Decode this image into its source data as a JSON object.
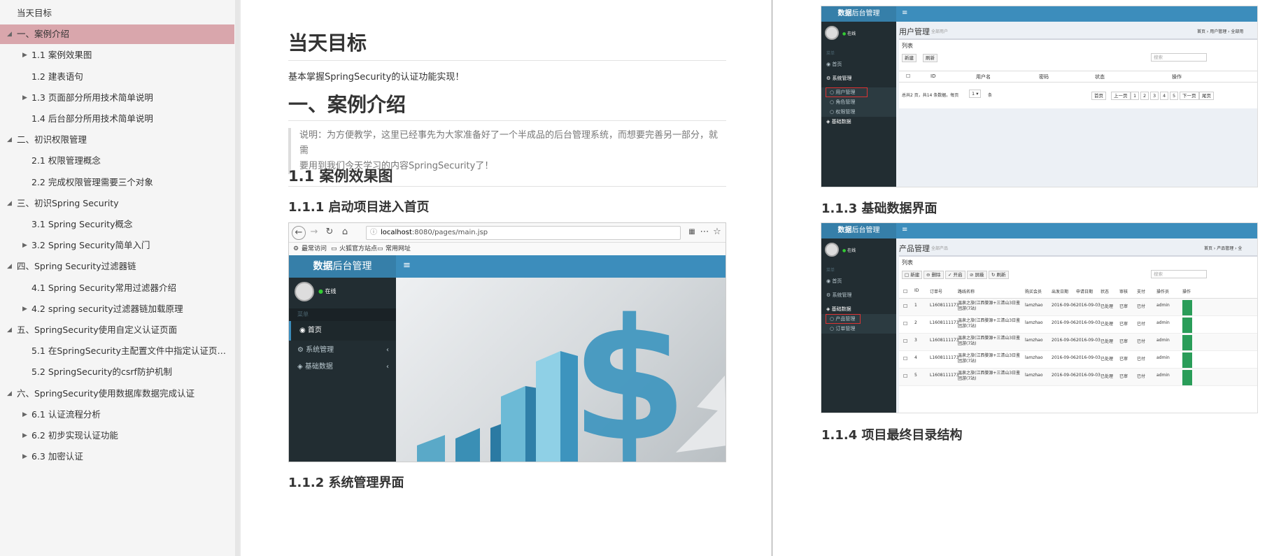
{
  "outline": {
    "items": [
      {
        "label": "当天目标",
        "level": 0,
        "arrow": ""
      },
      {
        "label": "一、案例介绍",
        "level": 0,
        "arrow": "◢",
        "selected": true
      },
      {
        "label": "1.1 案例效果图",
        "level": 1,
        "arrow": "▶"
      },
      {
        "label": "1.2 建表语句",
        "level": 1,
        "arrow": ""
      },
      {
        "label": "1.3 页面部分所用技术简单说明",
        "level": 1,
        "arrow": "▶"
      },
      {
        "label": "1.4 后台部分所用技术简单说明",
        "level": 1,
        "arrow": ""
      },
      {
        "label": "二、初识权限管理",
        "level": 0,
        "arrow": "◢"
      },
      {
        "label": "2.1 权限管理概念",
        "level": 1,
        "arrow": ""
      },
      {
        "label": "2.2 完成权限管理需要三个对象",
        "level": 1,
        "arrow": ""
      },
      {
        "label": "三、初识Spring Security",
        "level": 0,
        "arrow": "◢"
      },
      {
        "label": "3.1 Spring Security概念",
        "level": 1,
        "arrow": ""
      },
      {
        "label": "3.2 Spring Security简单入门",
        "level": 1,
        "arrow": "▶"
      },
      {
        "label": "四、Spring Security过滤器链",
        "level": 0,
        "arrow": "◢"
      },
      {
        "label": "4.1 Spring Security常用过滤器介绍",
        "level": 1,
        "arrow": ""
      },
      {
        "label": "4.2 spring security过滤器链加载原理",
        "level": 1,
        "arrow": "▶"
      },
      {
        "label": "五、SpringSecurity使用自定义认证页面",
        "level": 0,
        "arrow": "◢"
      },
      {
        "label": "5.1 在SpringSecurity主配置文件中指定认证页面配...",
        "level": 1,
        "arrow": ""
      },
      {
        "label": "5.2 SpringSecurity的csrf防护机制",
        "level": 1,
        "arrow": ""
      },
      {
        "label": "六、SpringSecurity使用数据库数据完成认证",
        "level": 0,
        "arrow": "◢"
      },
      {
        "label": "6.1 认证流程分析",
        "level": 1,
        "arrow": "▶"
      },
      {
        "label": "6.2 初步实现认证功能",
        "level": 1,
        "arrow": "▶"
      },
      {
        "label": "6.3 加密认证",
        "level": 1,
        "arrow": "▶"
      }
    ]
  },
  "page1": {
    "h_goal": "当天目标",
    "goal_text": "基本掌握SpringSecurity的认证功能实现！",
    "h_case": "一、案例介绍",
    "quote_line1": "说明：为方便教学，这里已经事先为大家准备好了一个半成品的后台管理系统，而想要完善另一部分，就需",
    "quote_line2": "要用到我们今天学习的内容SpringSecurity了！",
    "h_11": "1.1 案例效果图",
    "h_111": "1.1.1 启动项目进入首页",
    "h_112": "1.1.2 系统管理界面"
  },
  "browser": {
    "url_host": "localhost",
    "url_rest": ":8080/pages/main.jsp",
    "bookmarks": [
      "最常访问",
      "火狐官方站点",
      "常用网址"
    ],
    "logo_bold": "数据",
    "logo_rest": "后台管理",
    "online": "在线",
    "menu_header": "菜单",
    "menu": [
      "首页",
      "系统管理",
      "基础数据"
    ]
  },
  "page2": {
    "h_113": "1.1.3 基础数据界面",
    "h_114": "1.1.4 项目最终目录结构"
  },
  "thumb1": {
    "logo_bold": "数据",
    "logo_rest": "后台管理",
    "online": "在线",
    "menu_header": "菜单",
    "title": "用户管理",
    "subtitle": "全部用户",
    "crumb": "首页 › 用户管理 › 全部用",
    "box_title": "列表",
    "btn_new": "新建",
    "btn_refresh": "刷新",
    "search": "搜索",
    "cols": [
      "ID",
      "用户名",
      "密码",
      "状态",
      "操作"
    ],
    "page_info": "总共2 页，共14 条数据。每页",
    "page_size": "1",
    "page_unit": "条",
    "pager": [
      "首页",
      "上一页",
      "1",
      "2",
      "3",
      "4",
      "5",
      "下一页",
      "尾页"
    ],
    "side": [
      "首页",
      "系统管理",
      "用户管理",
      "角色管理",
      "权限管理",
      "基础数据"
    ]
  },
  "thumb2": {
    "logo_bold": "数据",
    "logo_rest": "后台管理",
    "online": "在线",
    "menu_header": "菜单",
    "title": "产品管理",
    "subtitle": "全部产品",
    "crumb": "首页 › 产品管理 › 全",
    "box_title": "列表",
    "btns": [
      "新建",
      "删除",
      "开启",
      "屏蔽",
      "刷新"
    ],
    "cols": [
      "ID",
      "订单号",
      "路线名称",
      "购买会员",
      "出发日期",
      "申请日期",
      "状态",
      "审核",
      "支付",
      "操作员",
      "操作"
    ],
    "side": [
      "首页",
      "系统管理",
      "基础数据",
      "产品管理",
      "订单管理"
    ],
    "rows": [
      {
        "id": "1",
        "no": "L1608111173",
        "route": "温泉之旅(江西婺源+三清山3日鉴团游(7站)",
        "member": "lamzhao",
        "dep": "2016-09-06",
        "app": "2016-09-03",
        "state": "已处理",
        "audit": "已审",
        "pay": "已付",
        "op": "admin"
      },
      {
        "id": "2",
        "no": "L1608111173",
        "route": "温泉之旅(江西婺源+三清山3日鉴团游(7站)",
        "member": "lamzhao",
        "dep": "2016-09-06",
        "app": "2016-09-03",
        "state": "已处理",
        "audit": "已审",
        "pay": "已付",
        "op": "admin"
      },
      {
        "id": "3",
        "no": "L1608111173",
        "route": "温泉之旅(江西婺源+三清山3日鉴团游(7站)",
        "member": "lamzhao",
        "dep": "2016-09-06",
        "app": "2016-09-03",
        "state": "已处理",
        "audit": "已审",
        "pay": "已付",
        "op": "admin"
      },
      {
        "id": "4",
        "no": "L1608111173",
        "route": "温泉之旅(江西婺源+三清山3日鉴团游(7站)",
        "member": "lamzhao",
        "dep": "2016-09-06",
        "app": "2016-09-03",
        "state": "已处理",
        "audit": "已审",
        "pay": "已付",
        "op": "admin"
      },
      {
        "id": "5",
        "no": "L1608111173",
        "route": "温泉之旅(江西婺源+三清山3日鉴团游(7站)",
        "member": "lamzhao",
        "dep": "2016-09-06",
        "app": "2016-09-03",
        "state": "已处理",
        "audit": "已审",
        "pay": "已付",
        "op": "admin"
      }
    ]
  }
}
